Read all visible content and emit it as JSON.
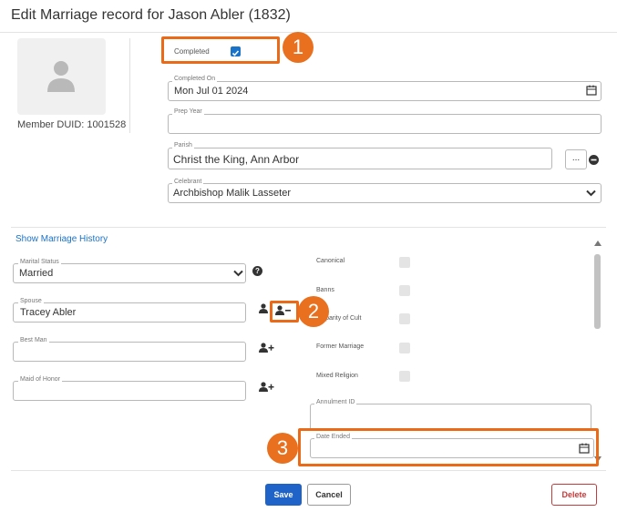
{
  "dialog": {
    "title": "Edit Marriage record for Jason Abler (1832)"
  },
  "member": {
    "duid": "Member DUID: 1001528"
  },
  "completed": {
    "label": "Completed"
  },
  "completed_on": {
    "label": "Completed On",
    "value": "Mon Jul 01 2024"
  },
  "prep_year": {
    "label": "Prep Year",
    "value": ""
  },
  "parish": {
    "label": "Parish",
    "value": "Christ the King, Ann Arbor",
    "browse": "..."
  },
  "celebrant": {
    "label": "Celebrant",
    "value": "Archbishop Malik Lasseter"
  },
  "history_link": "Show Marriage History",
  "marital_status": {
    "label": "Marital Status",
    "value": "Married"
  },
  "spouse": {
    "label": "Spouse",
    "value": "Tracey Abler"
  },
  "best_man": {
    "label": "Best Man",
    "value": ""
  },
  "maid_of_honor": {
    "label": "Maid of Honor",
    "value": ""
  },
  "checks": [
    "Canonical",
    "Banns",
    "Disparity of Cult",
    "Former Marriage",
    "Mixed Religion"
  ],
  "annulment_id": {
    "label": "Annulment ID"
  },
  "date_ended": {
    "label": "Date Ended"
  },
  "buttons": {
    "save": "Save",
    "cancel": "Cancel",
    "delete": "Delete"
  },
  "callouts": [
    "1",
    "2",
    "3"
  ],
  "colors": {
    "accent": "#1a73c9",
    "callout": "#ea6a17",
    "delete": "#c53a3a"
  }
}
